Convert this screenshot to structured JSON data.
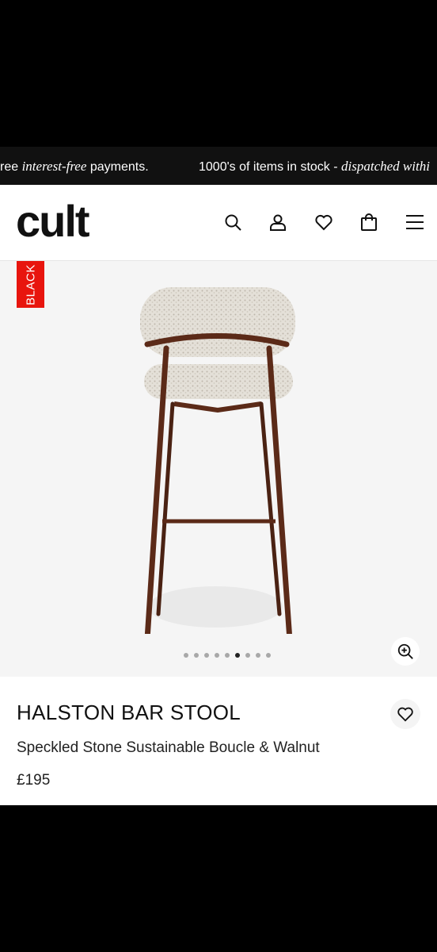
{
  "announcement": {
    "left_prefix": "ree ",
    "left_italic": "interest-free",
    "left_suffix": " payments.",
    "right_text": "1000's of items in stock - ",
    "right_italic": "dispatched withi"
  },
  "header": {
    "logo": "cult",
    "icons": [
      "search-icon",
      "account-icon",
      "wishlist-icon",
      "bag-icon",
      "menu-icon"
    ]
  },
  "gallery": {
    "badge": "BLACK",
    "image_count": 9,
    "active_index": 5,
    "zoom_icon": "zoom-in-icon"
  },
  "product": {
    "title": "HALSTON BAR STOOL",
    "variant": "Speckled Stone Sustainable Boucle & Walnut",
    "price": "£195"
  },
  "colors": {
    "badge_bg": "#e8150e",
    "frame": "#5b2a18",
    "fabric": "#e4e0d8"
  }
}
